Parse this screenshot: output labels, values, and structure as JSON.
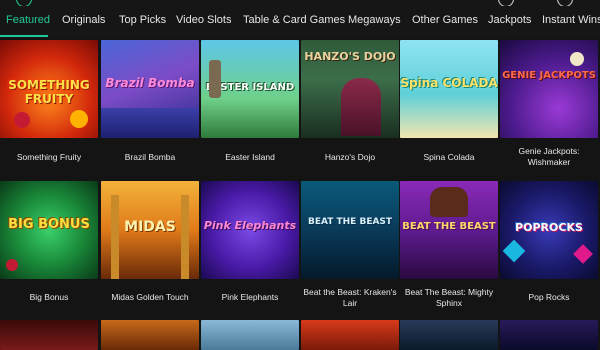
{
  "nav": {
    "items": [
      {
        "label": "Featured",
        "active": true
      },
      {
        "label": "Originals"
      },
      {
        "label": "Top Picks"
      },
      {
        "label": "Video Slots"
      },
      {
        "label": "Table & Card Games"
      },
      {
        "label": "Megaways"
      },
      {
        "label": "Other Games"
      },
      {
        "label": "Jackpots"
      },
      {
        "label": "Instant Wins"
      }
    ],
    "accent_color": "#20c997"
  },
  "games": [
    {
      "title": "Something Fruity",
      "logo": "SOMETHING FRUITY"
    },
    {
      "title": "Brazil Bomba",
      "logo": "Brazil Bomba"
    },
    {
      "title": "Easter Island",
      "logo": "EASTER ISLAND"
    },
    {
      "title": "Hanzo's Dojo",
      "logo": "HANZO'S DOJO"
    },
    {
      "title": "Spina Colada",
      "logo": "Spina COLADA"
    },
    {
      "title": "Genie Jackpots: Wishmaker",
      "logo": "GENIE JACKPOTS"
    },
    {
      "title": "Big Bonus",
      "logo": "BIG BONUS"
    },
    {
      "title": "Midas Golden Touch",
      "logo": "MIDAS"
    },
    {
      "title": "Pink Elephants",
      "logo": "Pink Elephants"
    },
    {
      "title": "Beat the Beast: Kraken's Lair",
      "logo": "BEAT THE BEAST"
    },
    {
      "title": "Beat The Beast: Mighty Sphinx",
      "logo": "BEAT THE BEAST"
    },
    {
      "title": "Pop Rocks",
      "logo": "POPROCKS"
    }
  ]
}
